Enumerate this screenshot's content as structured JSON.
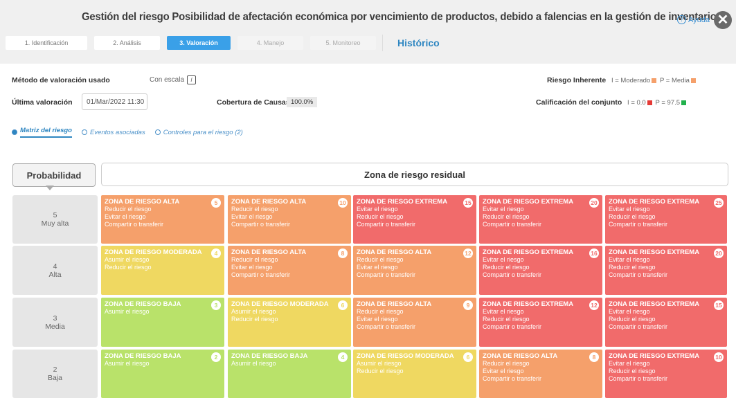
{
  "header": {
    "title": "Gestión del riesgo Posibilidad de afectación económica por vencimiento de productos, debido a falencias en la gestión de inventarios.",
    "help_label": "Ayuda",
    "help_icon": "question-circle-icon",
    "close_label": "✕"
  },
  "tabs": [
    {
      "label": "1. Identificación",
      "state": "normal"
    },
    {
      "label": "2. Análisis",
      "state": "normal"
    },
    {
      "label": "3. Valoración",
      "state": "active"
    },
    {
      "label": "4. Manejo",
      "state": "disabled"
    },
    {
      "label": "5. Monitoreo",
      "state": "disabled"
    }
  ],
  "historico_label": "Histórico",
  "info": {
    "metodo_label": "Método de valoración usado",
    "metodo_value": "Con escala",
    "ultima_label": "Última valoración",
    "ultima_value": "01/Mar/2022 11:30",
    "cobertura_label": "Cobertura de Causas",
    "cobertura_value": "100.0%",
    "inherente_label": "Riesgo Inherente",
    "inherente_i": "I = Moderado",
    "inherente_p": "P = Media",
    "calif_label": "Calificación del conjunto",
    "calif_i": "I = 0.0",
    "calif_p": "P = 97.5"
  },
  "subtabs": [
    {
      "label": "Matriz del riesgo",
      "active": true
    },
    {
      "label": "Eventos asociadas",
      "active": false
    },
    {
      "label": "Controles para el riesgo (2)",
      "active": false
    }
  ],
  "matrix": {
    "prob_label": "Probabilidad",
    "zone_label": "Zona de riesgo residual",
    "colors": {
      "baja": "#b9e26a",
      "moderada": "#efd861",
      "alta": "#f5a06b",
      "extrema": "#f16b6b"
    },
    "rows": [
      {
        "num": "5",
        "name": "Muy alta",
        "cells": [
          {
            "level": "alta",
            "title": "ZONA DE RIESGO ALTA",
            "score": "5",
            "lines": [
              "Reducir el riesgo",
              "Evitar el riesgo",
              "Compartir o transferir"
            ]
          },
          {
            "level": "alta",
            "title": "ZONA DE RIESGO ALTA",
            "score": "10",
            "lines": [
              "Reducir el riesgo",
              "Evitar el riesgo",
              "Compartir o transferir"
            ]
          },
          {
            "level": "extrema",
            "title": "ZONA DE RIESGO EXTREMA",
            "score": "15",
            "lines": [
              "Evitar el riesgo",
              "Reducir el riesgo",
              "Compartir o transferir"
            ]
          },
          {
            "level": "extrema",
            "title": "ZONA DE RIESGO EXTREMA",
            "score": "20",
            "lines": [
              "Evitar el riesgo",
              "Reducir el riesgo",
              "Compartir o transferir"
            ]
          },
          {
            "level": "extrema",
            "title": "ZONA DE RIESGO EXTREMA",
            "score": "25",
            "lines": [
              "Evitar el riesgo",
              "Reducir el riesgo",
              "Compartir o transferir"
            ]
          }
        ]
      },
      {
        "num": "4",
        "name": "Alta",
        "cells": [
          {
            "level": "moderada",
            "title": "ZONA DE RIESGO MODERADA",
            "score": "4",
            "lines": [
              "Asumir el riesgo",
              "Reducir el riesgo"
            ]
          },
          {
            "level": "alta",
            "title": "ZONA DE RIESGO ALTA",
            "score": "8",
            "lines": [
              "Reducir el riesgo",
              "Evitar el riesgo",
              "Compartir o transferir"
            ]
          },
          {
            "level": "alta",
            "title": "ZONA DE RIESGO ALTA",
            "score": "12",
            "lines": [
              "Reducir el riesgo",
              "Evitar el riesgo",
              "Compartir o transferir"
            ]
          },
          {
            "level": "extrema",
            "title": "ZONA DE RIESGO EXTREMA",
            "score": "16",
            "lines": [
              "Evitar el riesgo",
              "Reducir el riesgo",
              "Compartir o transferir"
            ]
          },
          {
            "level": "extrema",
            "title": "ZONA DE RIESGO EXTREMA",
            "score": "20",
            "lines": [
              "Evitar el riesgo",
              "Reducir el riesgo",
              "Compartir o transferir"
            ]
          }
        ]
      },
      {
        "num": "3",
        "name": "Media",
        "cells": [
          {
            "level": "baja",
            "title": "ZONA DE RIESGO BAJA",
            "score": "3",
            "lines": [
              "Asumir el riesgo"
            ]
          },
          {
            "level": "moderada",
            "title": "ZONA DE RIESGO MODERADA",
            "score": "6",
            "lines": [
              "Asumir el riesgo",
              "Reducir el riesgo"
            ]
          },
          {
            "level": "alta",
            "title": "ZONA DE RIESGO ALTA",
            "score": "9",
            "lines": [
              "Reducir el riesgo",
              "Evitar el riesgo",
              "Compartir o transferir"
            ]
          },
          {
            "level": "extrema",
            "title": "ZONA DE RIESGO EXTREMA",
            "score": "12",
            "lines": [
              "Evitar el riesgo",
              "Reducir el riesgo",
              "Compartir o transferir"
            ]
          },
          {
            "level": "extrema",
            "title": "ZONA DE RIESGO EXTREMA",
            "score": "15",
            "lines": [
              "Evitar el riesgo",
              "Reducir el riesgo",
              "Compartir o transferir"
            ]
          }
        ]
      },
      {
        "num": "2",
        "name": "Baja",
        "cells": [
          {
            "level": "baja",
            "title": "ZONA DE RIESGO BAJA",
            "score": "2",
            "lines": [
              "Asumir el riesgo"
            ]
          },
          {
            "level": "baja",
            "title": "ZONA DE RIESGO BAJA",
            "score": "4",
            "lines": [
              "Asumir el riesgo"
            ]
          },
          {
            "level": "moderada",
            "title": "ZONA DE RIESGO MODERADA",
            "score": "6",
            "lines": [
              "Asumir el riesgo",
              "Reducir el riesgo"
            ]
          },
          {
            "level": "alta",
            "title": "ZONA DE RIESGO ALTA",
            "score": "8",
            "lines": [
              "Reducir el riesgo",
              "Evitar el riesgo",
              "Compartir o transferir"
            ]
          },
          {
            "level": "extrema",
            "title": "ZONA DE RIESGO EXTREMA",
            "score": "10",
            "lines": [
              "Evitar el riesgo",
              "Reducir el riesgo",
              "Compartir o transferir"
            ]
          }
        ]
      }
    ]
  }
}
